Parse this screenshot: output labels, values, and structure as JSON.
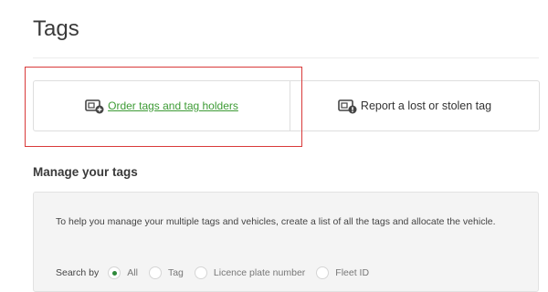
{
  "page": {
    "title": "Tags"
  },
  "actions": {
    "order": {
      "label": "Order tags and tag holders",
      "icon": "tag-add-icon"
    },
    "report": {
      "label": "Report a lost or stolen tag",
      "icon": "tag-alert-icon"
    }
  },
  "manage": {
    "title": "Manage your tags",
    "help": "To help you manage your multiple tags and vehicles, create a list of all the tags and allocate the vehicle.",
    "search_label": "Search by",
    "options": [
      {
        "label": "All",
        "selected": true
      },
      {
        "label": "Tag",
        "selected": false
      },
      {
        "label": "Licence plate number",
        "selected": false
      },
      {
        "label": "Fleet ID",
        "selected": false
      }
    ]
  },
  "colors": {
    "link": "#3d9b35",
    "highlight": "#d93a3a",
    "radio_selected": "#2f8a3b"
  }
}
